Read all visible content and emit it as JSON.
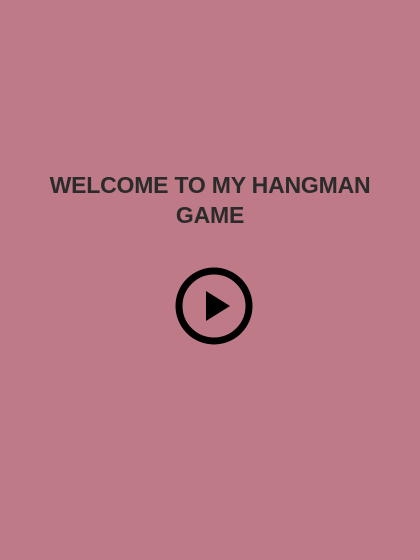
{
  "screen": {
    "title": "WELCOME TO MY HANGMAN GAME",
    "background_color": "#be7a86",
    "text_color": "#2b2b2b"
  },
  "play_button": {
    "icon": "play-circle-icon",
    "color": "#000000"
  }
}
